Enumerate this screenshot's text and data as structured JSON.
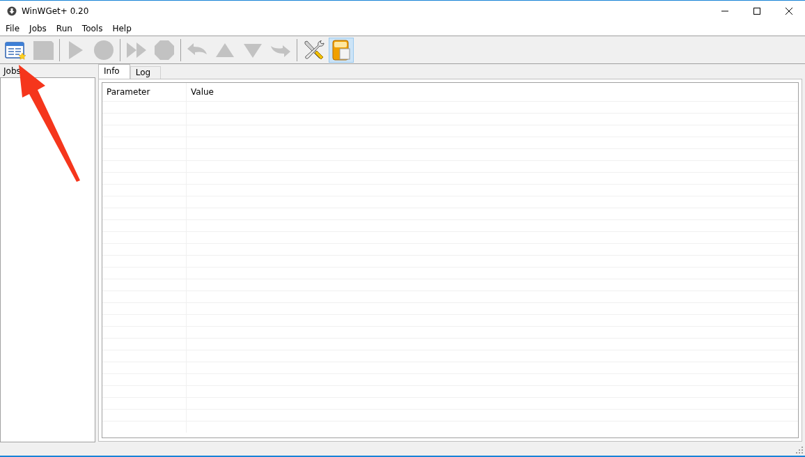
{
  "window": {
    "title": "WinWGet+ 0.20"
  },
  "menu": [
    "File",
    "Jobs",
    "Run",
    "Tools",
    "Help"
  ],
  "toolbar": [
    {
      "kind": "new-job",
      "disabled": false,
      "pressed": false
    },
    {
      "kind": "square",
      "disabled": true,
      "pressed": false
    },
    {
      "kind": "sep"
    },
    {
      "kind": "play",
      "disabled": true,
      "pressed": false
    },
    {
      "kind": "circle",
      "disabled": true,
      "pressed": false
    },
    {
      "kind": "sep"
    },
    {
      "kind": "fast-forward",
      "disabled": true,
      "pressed": false
    },
    {
      "kind": "octagon",
      "disabled": true,
      "pressed": false
    },
    {
      "kind": "sep"
    },
    {
      "kind": "turn-left",
      "disabled": true,
      "pressed": false
    },
    {
      "kind": "up",
      "disabled": true,
      "pressed": false
    },
    {
      "kind": "down",
      "disabled": true,
      "pressed": false
    },
    {
      "kind": "turn-right",
      "disabled": true,
      "pressed": false
    },
    {
      "kind": "sep"
    },
    {
      "kind": "tools",
      "disabled": false,
      "pressed": false
    },
    {
      "kind": "panel",
      "disabled": false,
      "pressed": true
    }
  ],
  "jobs_panel": {
    "title": "Jobs"
  },
  "tabs": [
    {
      "label": "Info",
      "selected": true
    },
    {
      "label": "Log",
      "selected": false
    }
  ],
  "table": {
    "columns": [
      "Parameter",
      "Value"
    ]
  }
}
